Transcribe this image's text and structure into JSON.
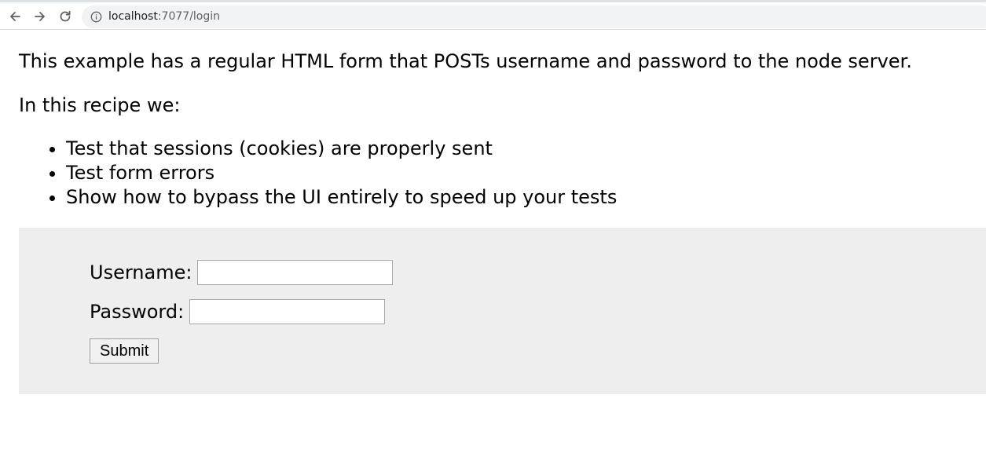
{
  "browser": {
    "url_host": "localhost",
    "url_path": ":7077/login"
  },
  "page": {
    "intro": "This example has a regular HTML form that POSTs username and password to the node server.",
    "recipe_intro": "In this recipe we:",
    "steps": [
      "Test that sessions (cookies) are properly sent",
      "Test form errors",
      "Show how to bypass the UI entirely to speed up your tests"
    ]
  },
  "form": {
    "username_label": "Username:",
    "username_value": "",
    "password_label": "Password:",
    "password_value": "",
    "submit_label": "Submit"
  },
  "colors": {
    "panel_background": "#eeeeee",
    "omnibox_background": "#f1f3f4"
  },
  "icons": [
    "back-arrow-icon",
    "forward-arrow-icon",
    "reload-icon",
    "info-icon"
  ]
}
